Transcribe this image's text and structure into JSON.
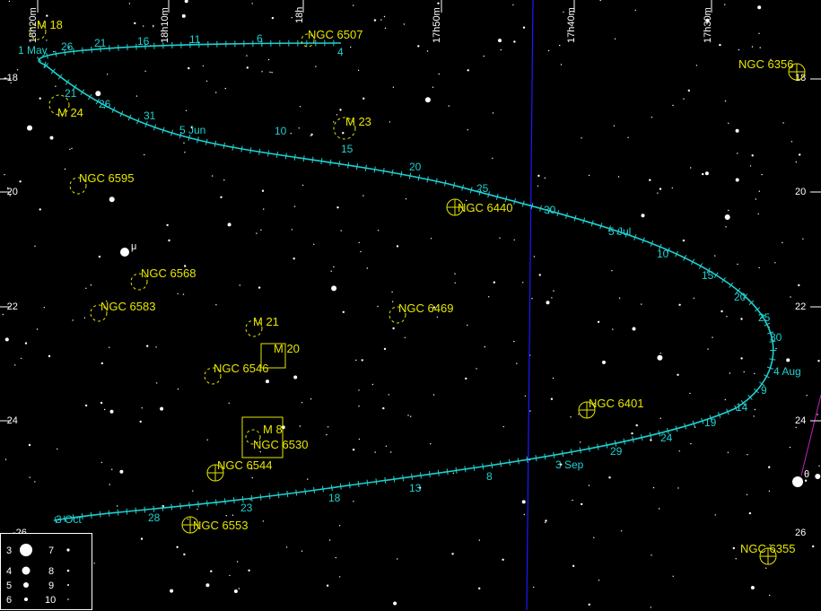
{
  "colors": {
    "background": "#000000",
    "path": "#20d0d0",
    "label_object": "#e6e600",
    "grid": "#ffffff",
    "meridian": "#1a1aff"
  },
  "ra_labels": [
    "18h20m",
    "18h10m",
    "18h",
    "17h50m",
    "17h40m",
    "17h30m"
  ],
  "dec_labels_left": [
    "-18",
    "-20",
    "-22",
    "-24",
    "-26"
  ],
  "dec_labels_right": [
    "18",
    "20",
    "22",
    "24",
    "26"
  ],
  "path_dates": {
    "major": [
      "1 May",
      "5 Jun",
      "5 Jul",
      "4 Aug",
      "3 Sep",
      "3 Oct"
    ],
    "minor": [
      "26",
      "21",
      "16",
      "11",
      "6",
      "4",
      "21",
      "26",
      "31",
      "10",
      "15",
      "20",
      "25",
      "30",
      "10",
      "15",
      "20",
      "25",
      "30",
      "9",
      "14",
      "19",
      "24",
      "29",
      "8",
      "13",
      "18",
      "23",
      "28"
    ]
  },
  "objects": [
    {
      "name": "M 18",
      "kind": "open-cluster"
    },
    {
      "name": "NGC 6507",
      "kind": "open-cluster"
    },
    {
      "name": "NGC 6356",
      "kind": "globular-cluster"
    },
    {
      "name": "M 24",
      "kind": "open-cluster"
    },
    {
      "name": "M 23",
      "kind": "open-cluster"
    },
    {
      "name": "NGC 6595",
      "kind": "open-cluster"
    },
    {
      "name": "NGC 6440",
      "kind": "globular-cluster"
    },
    {
      "name": "NGC 6568",
      "kind": "open-cluster"
    },
    {
      "name": "NGC 6583",
      "kind": "open-cluster"
    },
    {
      "name": "NGC 6469",
      "kind": "open-cluster"
    },
    {
      "name": "M 21",
      "kind": "open-cluster"
    },
    {
      "name": "M 20",
      "kind": "nebula"
    },
    {
      "name": "NGC 6546",
      "kind": "open-cluster"
    },
    {
      "name": "NGC 6401",
      "kind": "globular-cluster"
    },
    {
      "name": "M 8",
      "kind": "nebula"
    },
    {
      "name": "NGC 6530",
      "kind": "open-cluster"
    },
    {
      "name": "NGC 6544",
      "kind": "globular-cluster"
    },
    {
      "name": "NGC 6553",
      "kind": "globular-cluster"
    },
    {
      "name": "NGC 6355",
      "kind": "globular-cluster"
    }
  ],
  "star_labels": [
    "μ",
    "θ"
  ],
  "legend": {
    "magnitudes": [
      "3",
      "4",
      "5",
      "6",
      "7",
      "8",
      "9",
      "10"
    ]
  }
}
